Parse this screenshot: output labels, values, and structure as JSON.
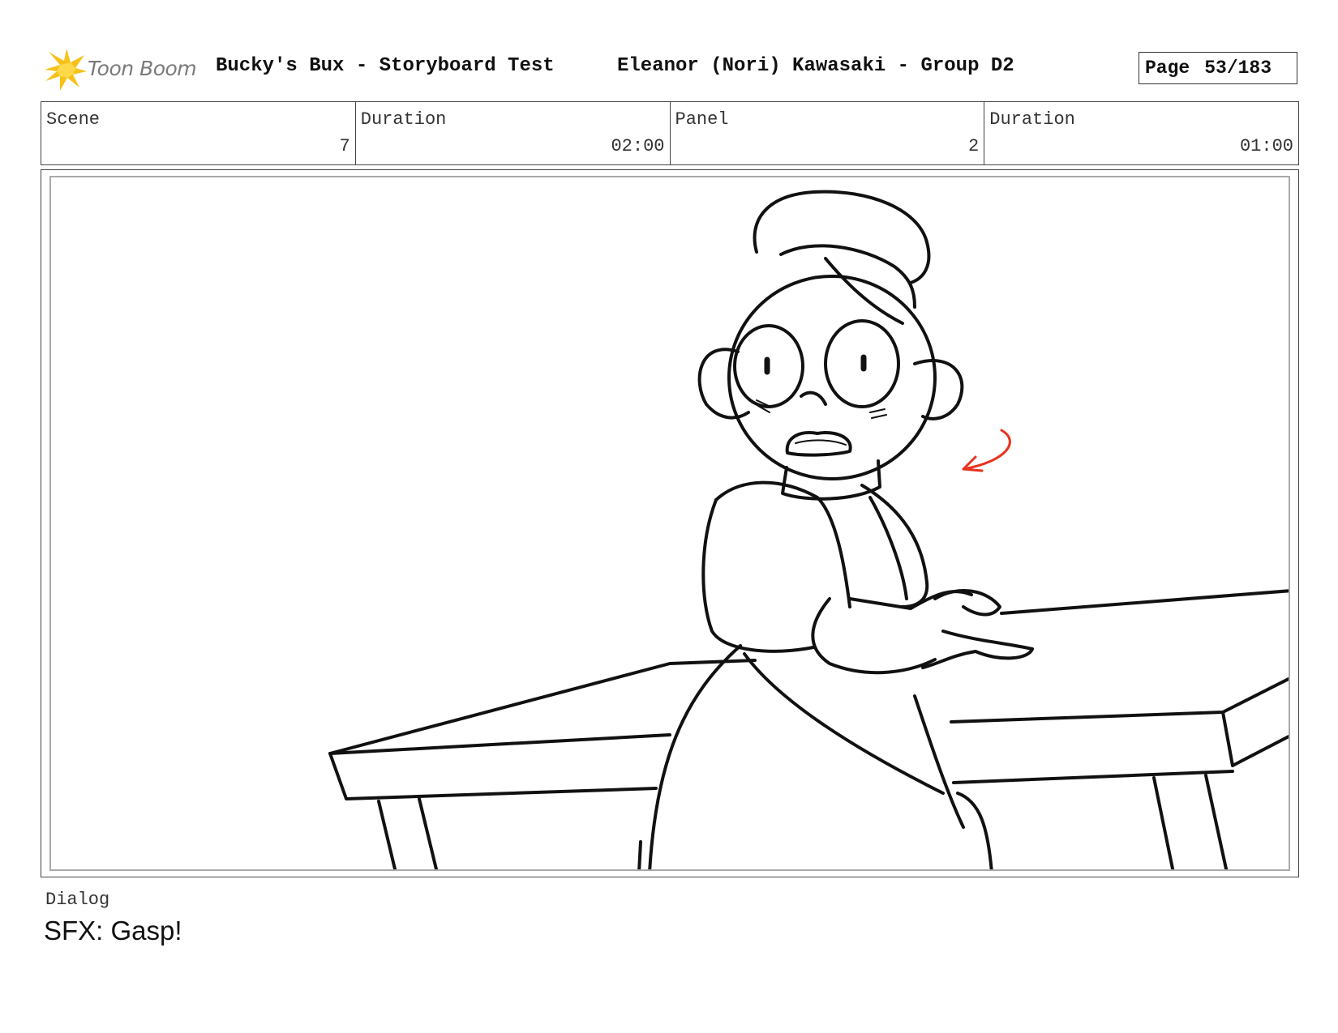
{
  "header": {
    "logo_text": "Toon Boom",
    "logo_icon": "toon-boom-star-icon",
    "project_title": "Bucky's Bux - Storyboard Test",
    "author": "Eleanor (Nori) Kawasaki - Group D2",
    "page_label": "Page",
    "page_value": "53/183"
  },
  "info": {
    "scene_label": "Scene",
    "scene_value": "7",
    "scene_duration_label": "Duration",
    "scene_duration_value": "02:00",
    "panel_label": "Panel",
    "panel_value": "2",
    "panel_duration_label": "Duration",
    "panel_duration_value": "01:00"
  },
  "panel": {
    "drawing": "storyboard-sketch",
    "accent_color": "#e8321e"
  },
  "dialog": {
    "label": "Dialog",
    "text": "SFX: Gasp!"
  },
  "colors": {
    "logo_yellow": "#f6c21a",
    "logo_text": "#7a7a7a",
    "border": "#444444"
  }
}
